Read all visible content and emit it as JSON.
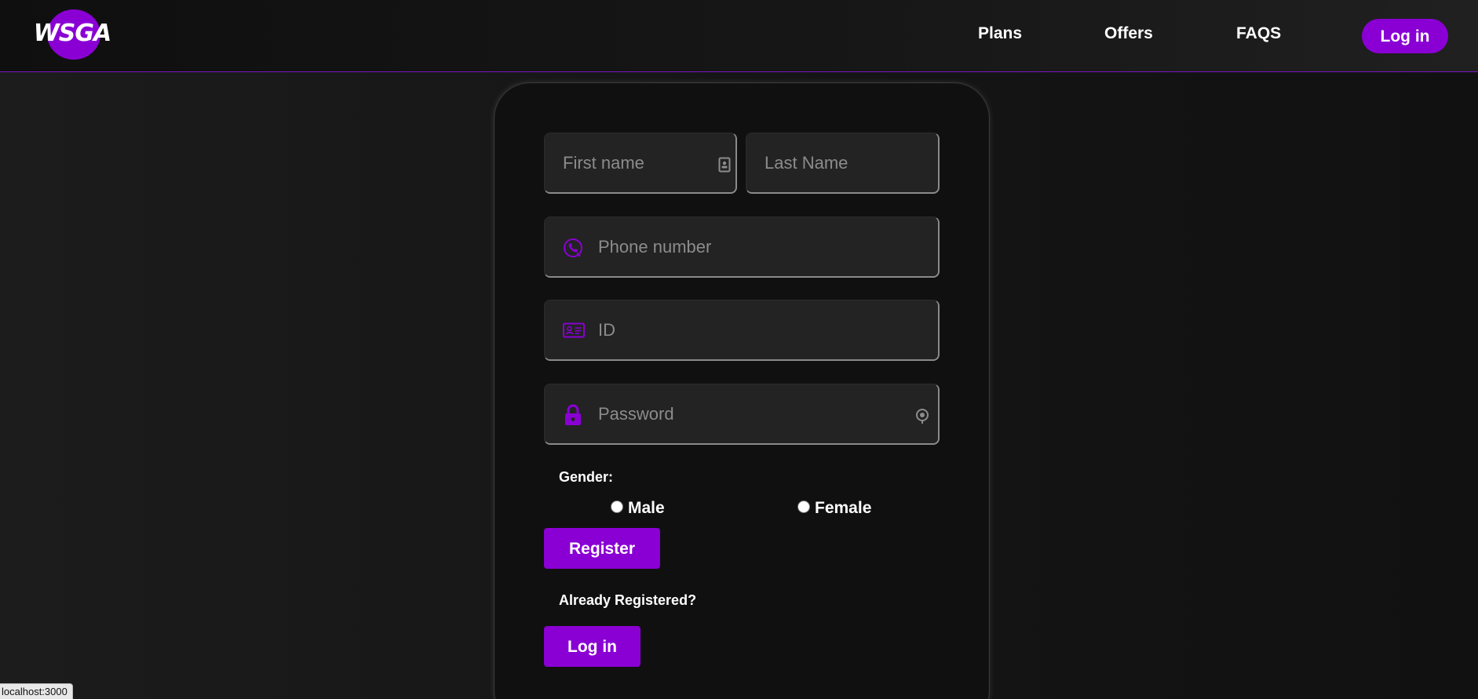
{
  "header": {
    "logo_text": "WSGA",
    "nav": {
      "plans": "Plans",
      "offers": "Offers",
      "faqs": "FAQS",
      "login": "Log in"
    }
  },
  "form": {
    "first_name": {
      "placeholder": "First name",
      "icon": "contact-card-icon"
    },
    "last_name": {
      "placeholder": "Last Name"
    },
    "phone": {
      "placeholder": "Phone number",
      "icon": "phone-icon"
    },
    "id": {
      "placeholder": "ID",
      "icon": "id-card-icon"
    },
    "password": {
      "placeholder": "Password",
      "icon": "lock-icon",
      "toggle_icon": "eye-toggle-icon"
    },
    "gender_label": "Gender:",
    "gender_options": [
      "Male",
      "Female"
    ],
    "register_label": "Register",
    "already_registered": "Already Registered?",
    "login_label": "Log in"
  },
  "status_bar": {
    "url": "localhost:3000"
  },
  "colors": {
    "accent": "#8a00d4",
    "background": "#161616",
    "card": "#101010",
    "input": "#232323",
    "placeholder": "#8c8c8c"
  }
}
